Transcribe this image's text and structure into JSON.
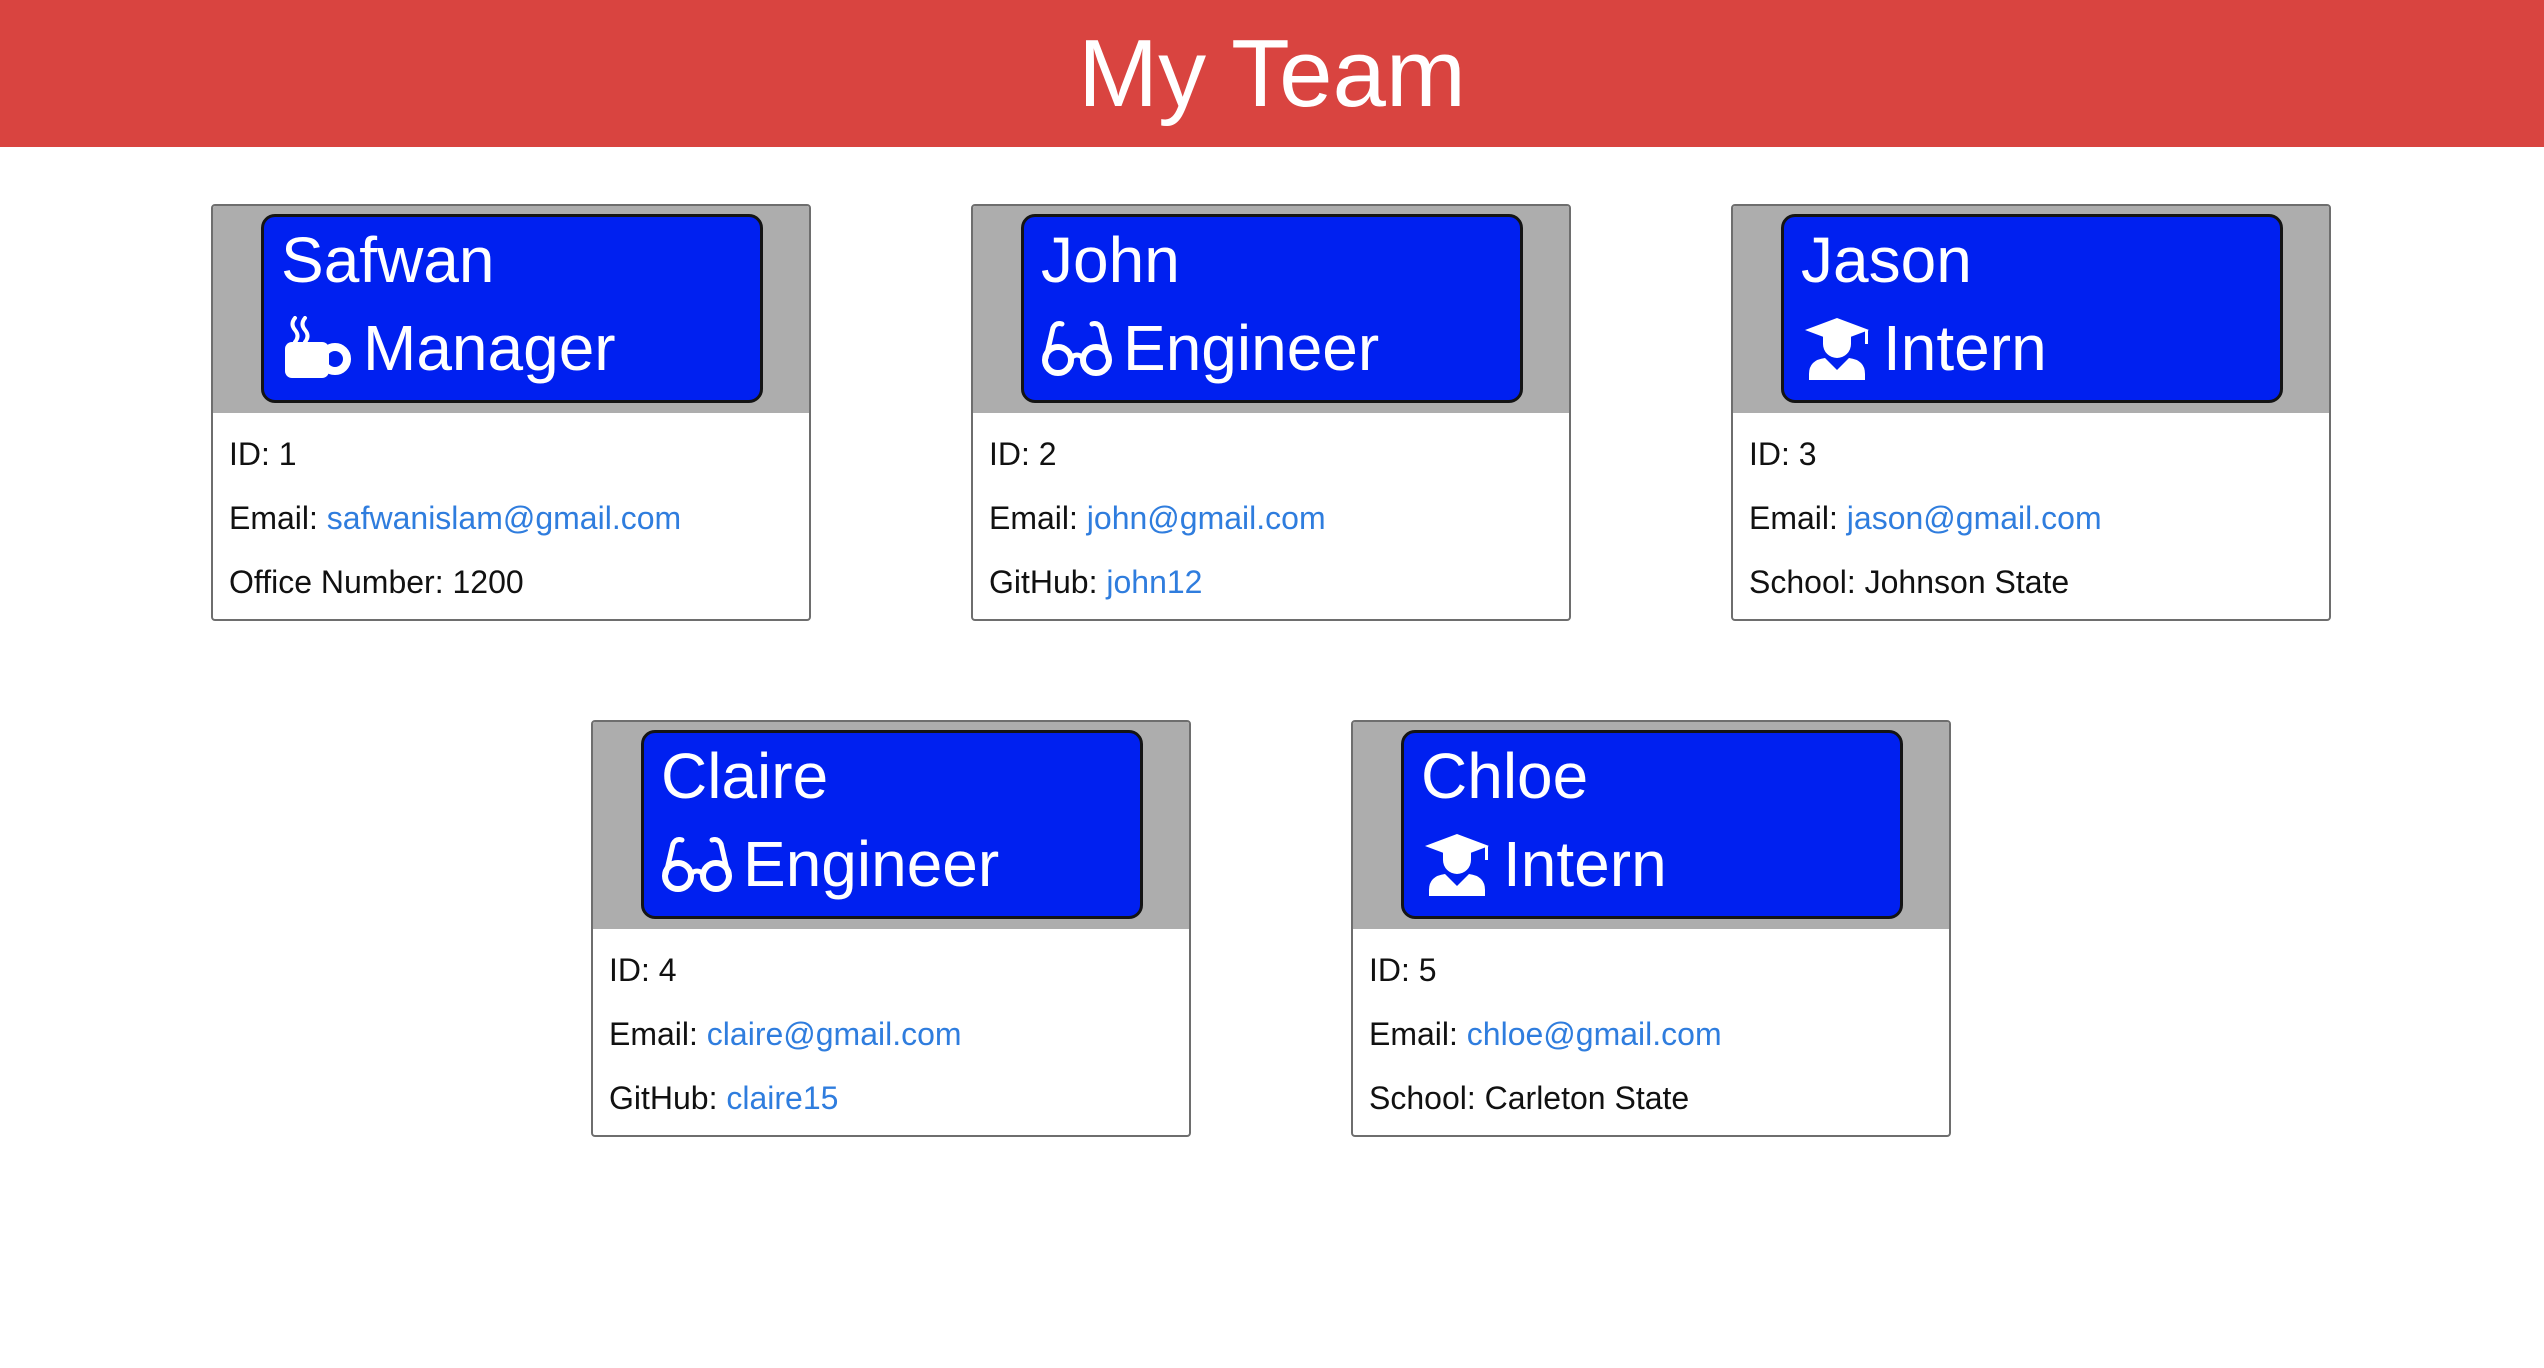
{
  "header": {
    "title": "My Team"
  },
  "members": [
    {
      "name": "Safwan",
      "role": "Manager",
      "icon": "coffee-icon",
      "id_label": "ID:",
      "id": "1",
      "email_label": "Email:",
      "email": "safwanislam@gmail.com",
      "extra_label": "Office Number:",
      "extra_value": "1200"
    },
    {
      "name": "John",
      "role": "Engineer",
      "icon": "glasses-icon",
      "id_label": "ID:",
      "id": "2",
      "email_label": "Email:",
      "email": "john@gmail.com",
      "extra_label": "GitHub:",
      "extra_value": "john12"
    },
    {
      "name": "Jason",
      "role": "Intern",
      "icon": "graduate-icon",
      "id_label": "ID:",
      "id": "3",
      "email_label": "Email:",
      "email": "jason@gmail.com",
      "extra_label": "School:",
      "extra_value": "Johnson State"
    },
    {
      "name": "Claire",
      "role": "Engineer",
      "icon": "glasses-icon",
      "id_label": "ID:",
      "id": "4",
      "email_label": "Email:",
      "email": "claire@gmail.com",
      "extra_label": "GitHub:",
      "extra_value": "claire15"
    },
    {
      "name": "Chloe",
      "role": "Intern",
      "icon": "graduate-icon",
      "id_label": "ID:",
      "id": "5",
      "email_label": "Email:",
      "email": "chloe@gmail.com",
      "extra_label": "School:",
      "extra_value": "Carleton State"
    }
  ],
  "colors": {
    "banner": "#d94440",
    "title_box": "#0020f0",
    "card_header": "#adadad",
    "link": "#2f7dde"
  }
}
